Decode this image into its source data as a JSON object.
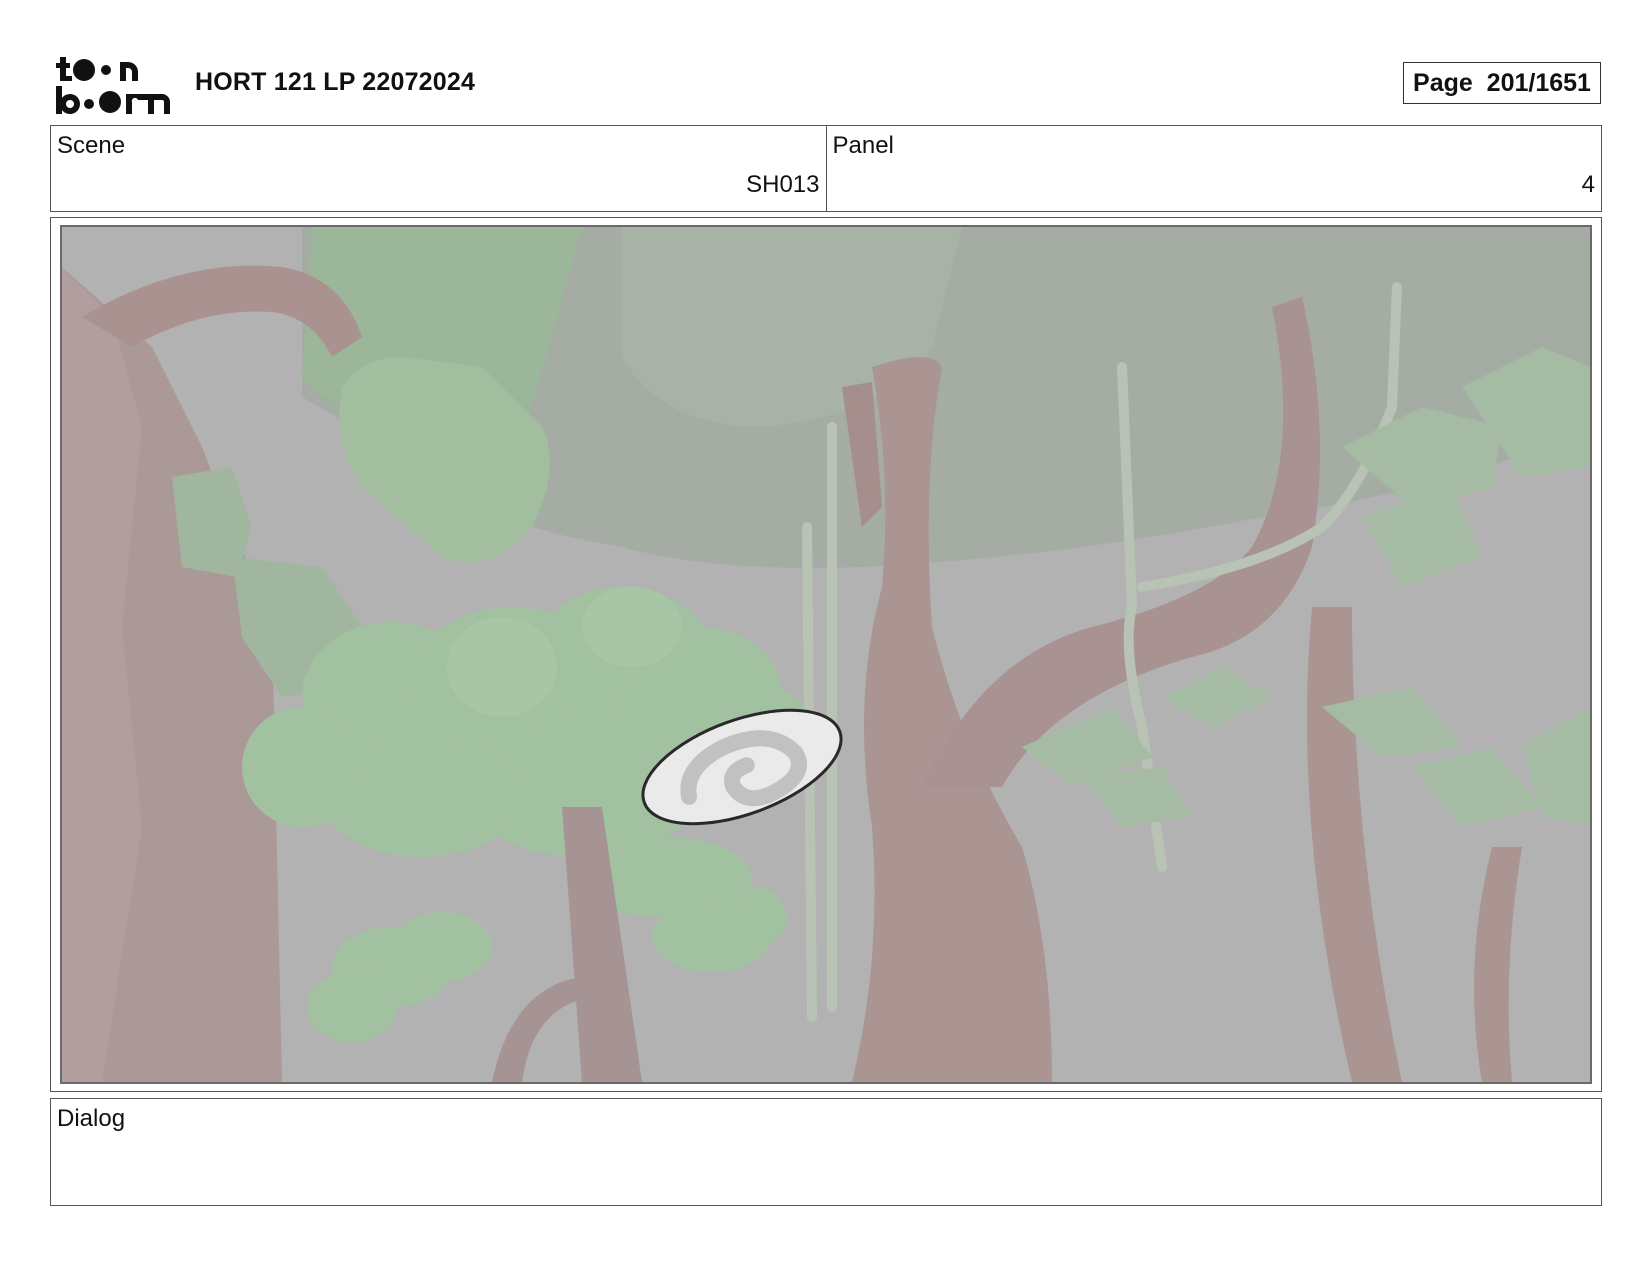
{
  "header": {
    "logo_text": "toon boom",
    "title": "HORT 121 LP 22072024",
    "page_label": "Page  201/1651"
  },
  "scene": {
    "label": "Scene",
    "value": "SH013"
  },
  "panel": {
    "label": "Panel",
    "value": "4"
  },
  "dialog": {
    "label": "Dialog",
    "text": ""
  },
  "colors": {
    "background_gray": "#b2b2b2",
    "foliage_green": "#9fbf9a",
    "trunk_brown": "#a38f8d"
  }
}
